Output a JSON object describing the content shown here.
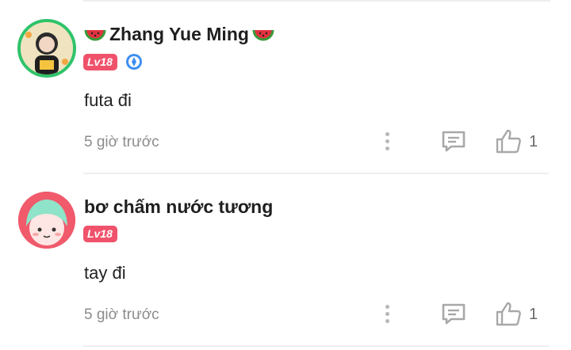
{
  "comments": [
    {
      "user": "Zhang Yue Ming",
      "level": "Lv18",
      "text": "futa đi",
      "time": "5 giờ trước",
      "likes": "1",
      "icons": [
        "avatar",
        "watermelon-icon",
        "verified-badge-icon",
        "more-icon",
        "reply-icon",
        "like-icon"
      ]
    },
    {
      "user": "bơ chấm nước tương",
      "level": "Lv18",
      "text": "tay đi",
      "time": "5 giờ trước",
      "likes": "1",
      "icons": [
        "avatar",
        "more-icon",
        "reply-icon",
        "like-icon"
      ]
    }
  ],
  "colors": {
    "level_badge": "#f0526b",
    "avatar_ring": "#2fc36b",
    "avatar2_bg": "#f05a6b",
    "meta_text": "#8c8c8c"
  }
}
